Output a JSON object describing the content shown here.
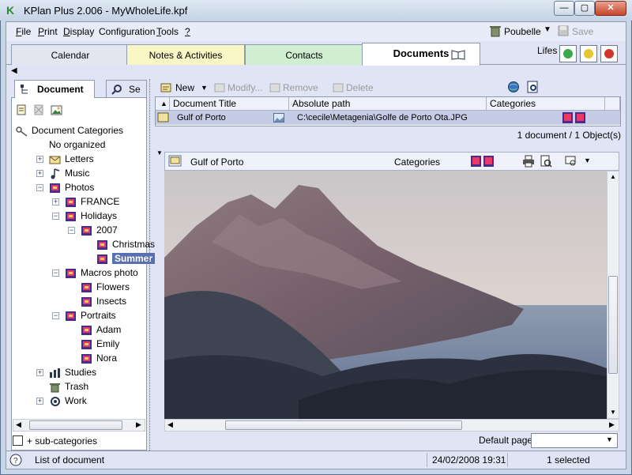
{
  "window": {
    "title": "KPlan Plus 2.006 - MyWholeLife.kpf",
    "logo": "K",
    "minimize_label": "—",
    "maximize_label": "▢",
    "close_label": "✕"
  },
  "menu": {
    "items": [
      {
        "key": "F",
        "rest": "ile"
      },
      {
        "key": "P",
        "rest": "rint"
      },
      {
        "key": "D",
        "rest": "isplay"
      },
      {
        "key": "",
        "rest": "Configuration"
      },
      {
        "key": "T",
        "rest": "ools"
      },
      {
        "key": "?",
        "rest": ""
      }
    ],
    "poubelle_label": "Poubelle",
    "save_label": "Save"
  },
  "tabs": {
    "items": [
      "Calendar",
      "Notes & Activities",
      "Contacts",
      "Documents"
    ],
    "active": "Documents",
    "lifes_label": "Lifes"
  },
  "colors": {
    "tab_calendar": "#e4e7f2",
    "tab_notes": "#fbf6c6",
    "tab_contacts": "#cfefd0",
    "tab_documents": "#ffffff",
    "selection": "#5a6fb0",
    "row_selected": "#c6cce6"
  },
  "left_panel": {
    "tabs": [
      "Document",
      "Se"
    ],
    "tree": [
      {
        "label": "Document Categories",
        "depth": 0,
        "icon": "key-icon",
        "expander": ""
      },
      {
        "label": "No organized",
        "depth": 1,
        "icon": "",
        "expander": ""
      },
      {
        "label": "Letters",
        "depth": 1,
        "icon": "letters-icon",
        "expander": "+"
      },
      {
        "label": "Music",
        "depth": 1,
        "icon": "music-icon",
        "expander": "+"
      },
      {
        "label": "Photos",
        "depth": 1,
        "icon": "photo-folder-icon",
        "expander": "−"
      },
      {
        "label": "FRANCE",
        "depth": 2,
        "icon": "photo-folder-icon",
        "expander": "+"
      },
      {
        "label": "Holidays",
        "depth": 2,
        "icon": "photo-folder-icon",
        "expander": "−"
      },
      {
        "label": "2007",
        "depth": 3,
        "icon": "photo-folder-icon",
        "expander": "−"
      },
      {
        "label": "Christmas",
        "depth": 4,
        "icon": "photo-folder-icon",
        "expander": ""
      },
      {
        "label": "Summer",
        "depth": 4,
        "icon": "photo-folder-icon",
        "expander": "",
        "selected": true
      },
      {
        "label": "Macros photo",
        "depth": 2,
        "icon": "photo-folder-icon",
        "expander": "−"
      },
      {
        "label": "Flowers",
        "depth": 3,
        "icon": "photo-folder-icon",
        "expander": ""
      },
      {
        "label": "Insects",
        "depth": 3,
        "icon": "photo-folder-icon",
        "expander": ""
      },
      {
        "label": "Portraits",
        "depth": 2,
        "icon": "photo-folder-icon",
        "expander": "−"
      },
      {
        "label": "Adam",
        "depth": 3,
        "icon": "photo-folder-icon",
        "expander": ""
      },
      {
        "label": "Emily",
        "depth": 3,
        "icon": "photo-folder-icon",
        "expander": ""
      },
      {
        "label": "Nora",
        "depth": 3,
        "icon": "photo-folder-icon",
        "expander": ""
      },
      {
        "label": "Studies",
        "depth": 1,
        "icon": "studies-icon",
        "expander": "+"
      },
      {
        "label": "Trash",
        "depth": 1,
        "icon": "trash-icon",
        "expander": ""
      },
      {
        "label": "Work",
        "depth": 1,
        "icon": "work-icon",
        "expander": "+"
      }
    ],
    "subcategories_label": "+ sub-categories"
  },
  "toolbar": {
    "new_label": "New",
    "modify_label": "Modify...",
    "remove_label": "Remove",
    "delete_label": "Delete"
  },
  "grid": {
    "columns": [
      "Document Title",
      "Absolute path",
      "Categories"
    ],
    "rows": [
      {
        "title": "Gulf of Porto",
        "path": "C:\\cecile\\Metagenia\\Golfe de Porto Ota.JPG"
      }
    ],
    "count_text": "1 document / 1 Object(s)"
  },
  "preview": {
    "title": "Gulf of Porto",
    "categories_label": "Categories"
  },
  "footer": {
    "default_page_label": "Default page:",
    "default_page_value": ""
  },
  "statusbar": {
    "list_label": "List of document",
    "datetime": "24/02/2008 19:31",
    "selected": "1 selected"
  }
}
